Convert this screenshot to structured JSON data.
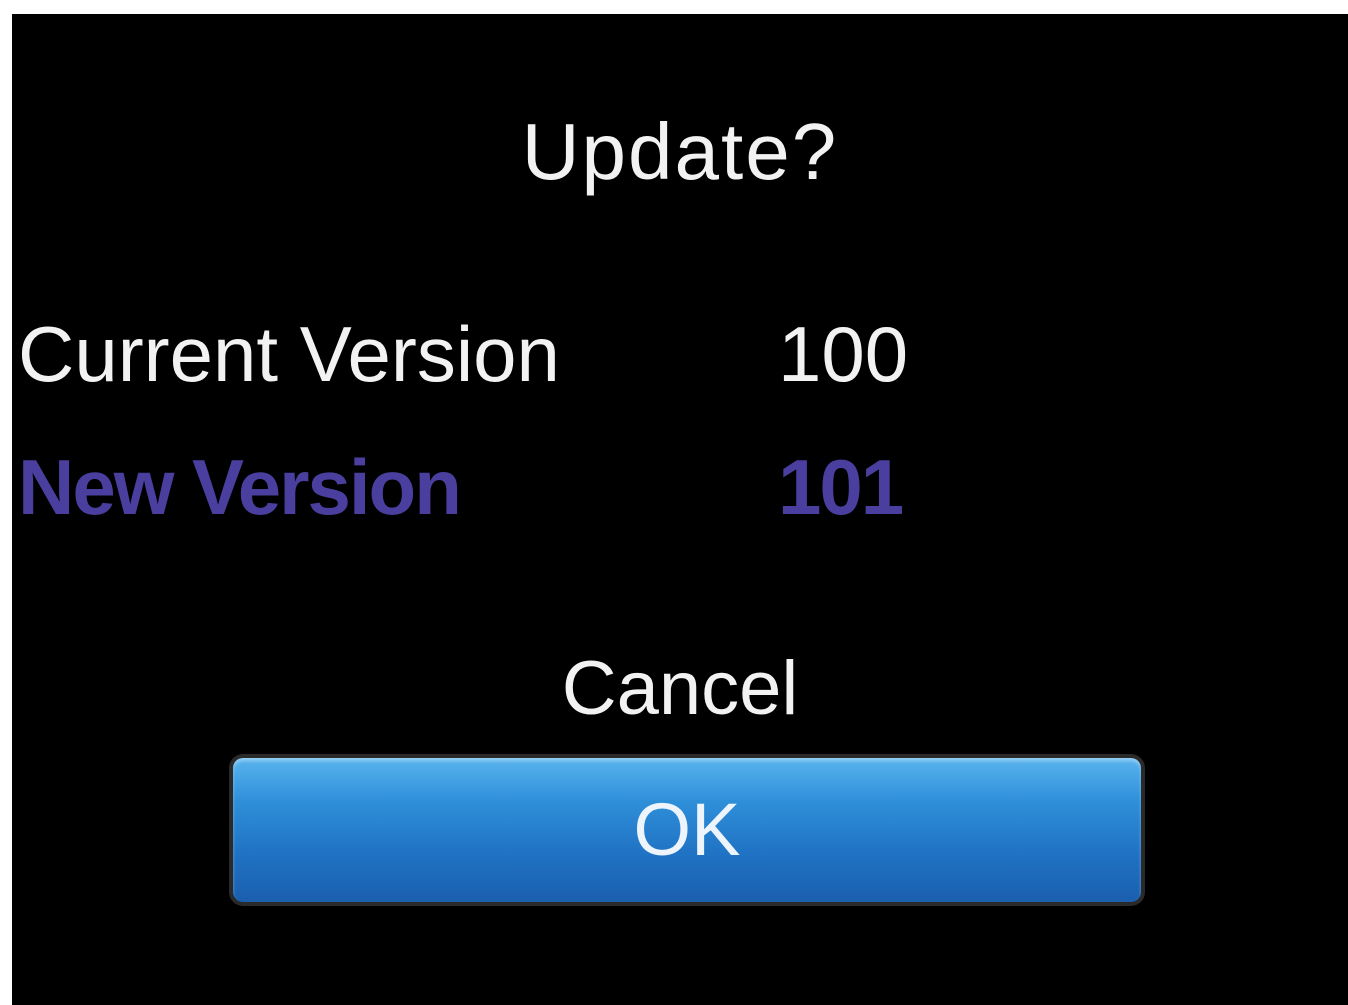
{
  "dialog": {
    "title": "Update?",
    "current_version": {
      "label": "Current Version",
      "value": "100"
    },
    "new_version": {
      "label": "New Version",
      "value": "101"
    },
    "cancel_label": "Cancel",
    "ok_label": "OK"
  },
  "colors": {
    "background": "#000000",
    "text": "#f2f2f2",
    "highlight": "#4a3f9e",
    "button_accent": "#2e8fd9"
  }
}
